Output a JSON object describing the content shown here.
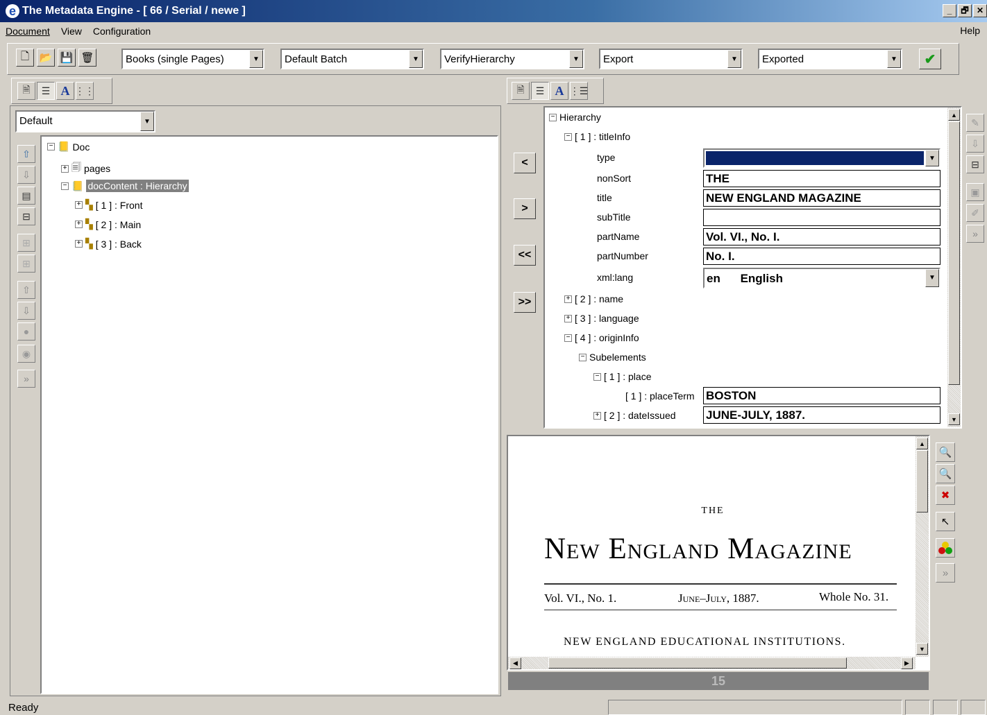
{
  "window": {
    "title": "The Metadata Engine - [ 66 / Serial / newe ]",
    "app_icon": "e",
    "controls": [
      "_",
      "🗗",
      "✕"
    ]
  },
  "menu": {
    "items": [
      "Document",
      "View",
      "Configuration"
    ],
    "help": "Help"
  },
  "toolbar": {
    "workflow": "Books (single Pages)",
    "batch": "Default Batch",
    "step": "VerifyHierarchy",
    "action": "Export",
    "status": "Exported",
    "ok_icon": "✔"
  },
  "left_panel": {
    "view_select": "Default",
    "tree": {
      "root": "Doc",
      "pages": "pages",
      "doc_content": "docContent : Hierarchy",
      "children": [
        "[ 1 ] : Front",
        "[ 2 ] : Main",
        "[ 3 ] : Back"
      ]
    },
    "more": "»"
  },
  "nav": {
    "prev": "<",
    "next": ">",
    "first": "<<",
    "last": ">>"
  },
  "hierarchy": {
    "root": "Hierarchy",
    "title_info": "[ 1 ] : titleInfo",
    "fields": {
      "type": {
        "label": "type",
        "value": ""
      },
      "nonSort": {
        "label": "nonSort",
        "value": "THE"
      },
      "title": {
        "label": "title",
        "value": "NEW ENGLAND MAGAZINE"
      },
      "subTitle": {
        "label": "subTitle",
        "value": ""
      },
      "partName": {
        "label": "partName",
        "value": "Vol. VI., No. I."
      },
      "partNumber": {
        "label": "partNumber",
        "value": "No. I."
      },
      "xmllang": {
        "label": "xml:lang",
        "code": "en",
        "language": "English"
      }
    },
    "name": "[ 2 ] : name",
    "language": "[ 3 ] : language",
    "origin_info": "[ 4 ] : originInfo",
    "subelements": "Subelements",
    "place": "[ 1 ] : place",
    "place_term": {
      "label": "[ 1 ] : placeTerm",
      "value": "BOSTON"
    },
    "date_issued": {
      "label": "[ 2 ] : dateIssued",
      "value": "JUNE-JULY, 1887."
    }
  },
  "page_image": {
    "the": "THE",
    "title": "New England Magazine",
    "vol": "Vol. VI., No. 1.",
    "date": "June–July, 1887.",
    "whole": "Whole No. 31.",
    "article": "NEW ENGLAND EDUCATIONAL INSTITUTIONS.",
    "page_number": "15"
  },
  "image_tools": {
    "more": "»"
  },
  "statusbar": {
    "text": "Ready"
  }
}
